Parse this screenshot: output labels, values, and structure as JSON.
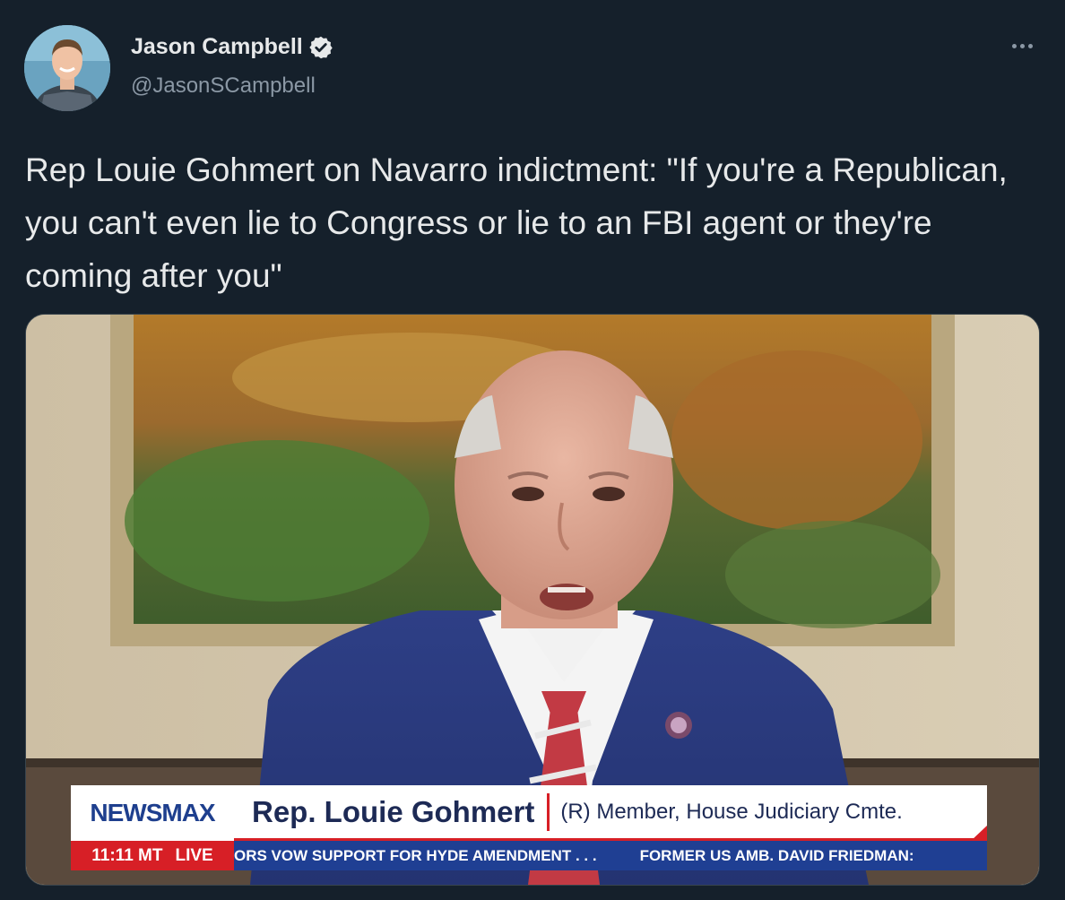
{
  "author": {
    "name": "Jason Campbell",
    "handle": "@JasonSCampbell",
    "verified_icon": "verified-badge-icon"
  },
  "more_icon": "more-options-icon",
  "tweet_text": "Rep Louie Gohmert on Navarro indictment: \"If you're a Republican, you can't even lie to Congress or lie to an FBI agent or they're coming after you\"",
  "video": {
    "channel_logo": "NEWSMAX",
    "lower_third_name": "Rep. Louie Gohmert",
    "lower_third_title": "(R) Member, House Judiciary Cmte.",
    "time": "11:11 MT",
    "live": "LIVE",
    "ticker_1": "ORS VOW SUPPORT FOR HYDE AMENDMENT . . .",
    "ticker_2": "FORMER US AMB. DAVID FRIEDMAN:"
  },
  "colors": {
    "background": "#15202b",
    "text": "#e7e9ea",
    "muted": "#8b98a5",
    "newsmax_blue": "#1f3f93",
    "newsmax_red": "#d71f26"
  }
}
